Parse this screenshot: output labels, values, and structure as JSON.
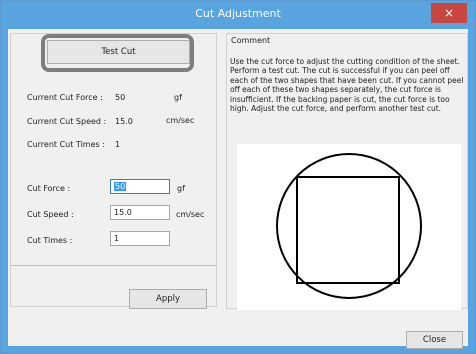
{
  "window": {
    "title": "Cut Adjustment",
    "close_glyph": "×"
  },
  "left": {
    "test_cut_label": "Test Cut",
    "current_cut_force_label": "Current Cut Force :",
    "current_cut_force_value": "50",
    "current_cut_force_unit": "gf",
    "current_cut_speed_label": "Current Cut Speed :",
    "current_cut_speed_value": "15.0",
    "current_cut_speed_unit": "cm/sec",
    "current_cut_times_label": "Current Cut Times :",
    "current_cut_times_value": "1",
    "cut_force_label": "Cut Force :",
    "cut_force_value": "50",
    "cut_force_unit": "gf",
    "cut_speed_label": "Cut Speed :",
    "cut_speed_value": "15.0",
    "cut_speed_unit": "cm/sec",
    "cut_times_label": "Cut Times :",
    "cut_times_value": "1",
    "apply_label": "Apply"
  },
  "comment": {
    "title": "Comment",
    "text": "Use the cut force to adjust the cutting condition of the sheet. Perform a test cut. The cut is successful if you can peel off each of the two shapes that have been cut. If you cannot peel off each of these two shapes separately, the cut force is insufficient. If the backing paper is cut, the cut force is too high. Adjust the cut force, and perform another test cut."
  },
  "footer": {
    "close_label": "Close"
  },
  "colors": {
    "titlebar": "#59a3de",
    "close_button": "#c9473f",
    "selection": "#3399ff"
  },
  "icons": {
    "close": "close-icon"
  }
}
